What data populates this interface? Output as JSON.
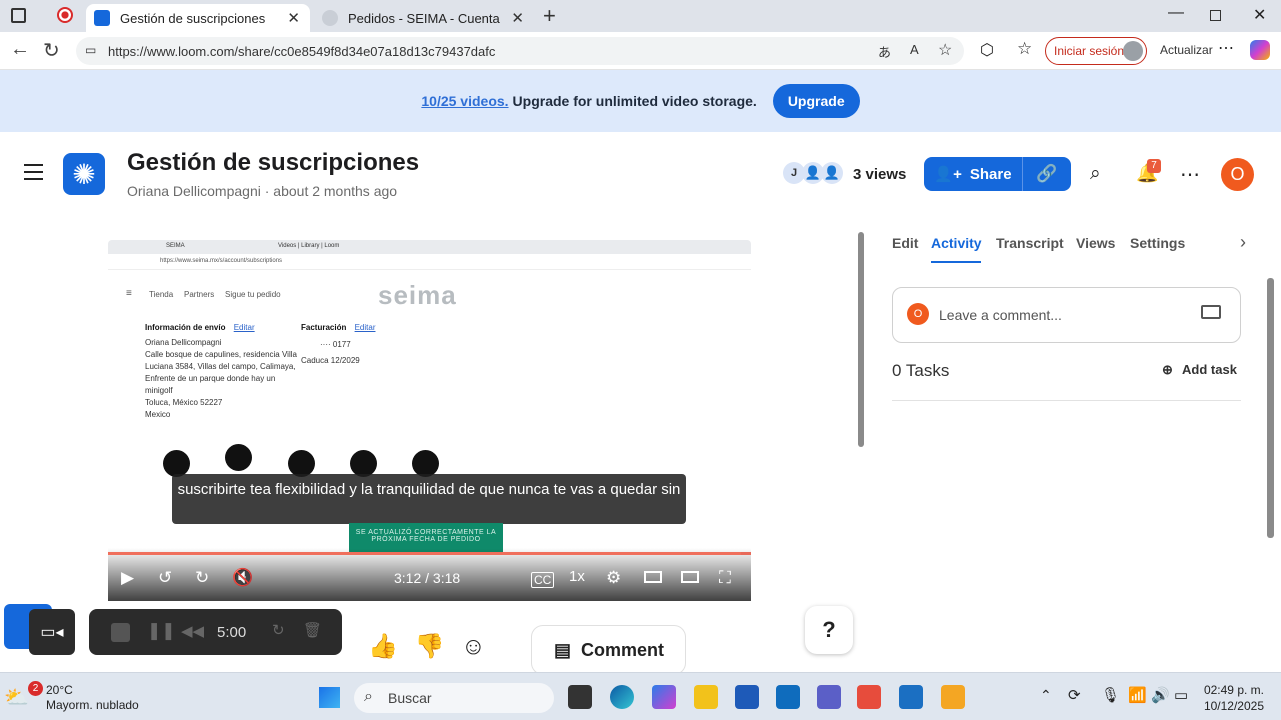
{
  "browser": {
    "tabs": [
      {
        "label": "Gestión de suscripciones"
      },
      {
        "label": "Pedidos - SEIMA - Cuenta"
      }
    ],
    "url": "https://www.loom.com/share/cc0e8549f8d34e07a18d13c79437dafc",
    "signin_label": "Iniciar sesión",
    "update_label": "Actualizar"
  },
  "banner": {
    "count": "10/25 videos.",
    "text": "Upgrade for unlimited video storage.",
    "button": "Upgrade"
  },
  "header": {
    "title": "Gestión de suscripciones",
    "author": "Oriana Dellicompagni",
    "age": "about 2 months ago",
    "viewer_initial": "J",
    "views": "3 views",
    "share_label": "Share",
    "notif_count": "7",
    "user_initial": "O"
  },
  "video": {
    "inner_url": "https://www.seima.mx/s/account/subscriptions",
    "inner_tab1": "SEIMA",
    "inner_tab2": "Videos | Library | Loom",
    "nav": [
      "Tienda",
      "Partners",
      "Sigue tu pedido"
    ],
    "logo": "seima",
    "ship_title": "Información de envío",
    "ship_edit": "Editar",
    "ship_lines": [
      "Oriana Dellicompagni",
      "Calle bosque de capulines, residencia Villa",
      "Luciana 3584, Villas del campo, Calimaya,",
      "Enfrente de un parque donde hay un",
      "minigolf",
      "Toluca, México 52227",
      "Mexico"
    ],
    "bill_title": "Facturación",
    "bill_edit": "Editar",
    "card": "···· 0177",
    "expiry": "Caduca 12/2029",
    "subtitle": "suscribirte tea flexibilidad y la tranquilidad de que nunca te vas a quedar sin",
    "toast": "SE ACTUALIZÓ CORRECTAMENTE LA PRÓXIMA FECHA DE PEDIDO",
    "time": "3:12 / 3:18",
    "speed": "1x",
    "progress": 0.985
  },
  "panel": {
    "tabs": [
      "Edit",
      "Activity",
      "Transcript",
      "Views",
      "Settings"
    ],
    "comment_initial": "O",
    "comment_placeholder": "Leave a comment...",
    "tasks": "0 Tasks",
    "add_task": "Add task"
  },
  "recorder": {
    "time": "5:00"
  },
  "comment_button": "Comment",
  "help": "?",
  "taskbar": {
    "temp": "20°C",
    "weather": "Mayorm. nublado",
    "weather_badge": "2",
    "search": "Buscar",
    "time": "02:49 p. m.",
    "date": "10/12/2025"
  }
}
